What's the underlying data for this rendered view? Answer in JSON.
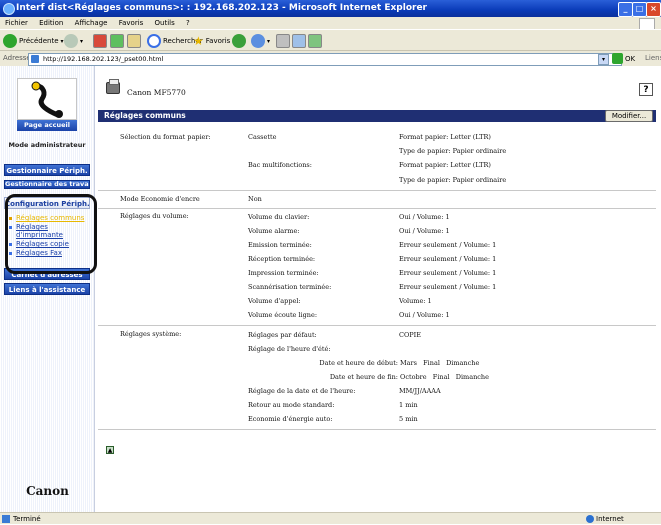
{
  "window": {
    "title": "Interf dist<Réglages communs>: : 192.168.202.123 - Microsoft Internet Explorer"
  },
  "menubar": {
    "items": [
      "Fichier",
      "Edition",
      "Affichage",
      "Favoris",
      "Outils",
      "?"
    ]
  },
  "toolbar": {
    "back_label": "Précédente",
    "search_label": "Rechercher",
    "favorites_label": "Favoris"
  },
  "addressbar": {
    "label": "Adresse",
    "url": "http://192.168.202.123/_pset00.html",
    "go_label": "OK",
    "links_label": "Liens"
  },
  "nav": {
    "home_label": "Page accueil",
    "mode_label": "Mode administrateur",
    "gestionnaire_label": "Gestionnaire Périph.",
    "gestionnaire_travaux_label": "Gestionnaire des travaux",
    "configuration_label": "Configuration Périph.",
    "sub_items": [
      "Réglages communs",
      "Réglages d'imprimante",
      "Réglages copie",
      "Réglages Fax"
    ],
    "carnet_label": "Carnet d'adresses",
    "liens_label": "Liens à l'assistance",
    "brand_label": "Canon"
  },
  "main": {
    "device_name": "Canon MF5770",
    "help_label": "?",
    "section_title": "Réglages communs",
    "modify_label": "Modifier...",
    "format": {
      "label": "Sélection du format papier:",
      "cassette_label": "Cassette",
      "cassette_size": "Format papier: Letter (LTR)",
      "cassette_type": "Type de papier: Papier ordinaire",
      "bac_label": "Bac multifonctions:",
      "bac_size": "Format papier: Letter (LTR)",
      "bac_type": "Type de papier: Papier ordinaire"
    },
    "eco_encre": {
      "label": "Mode Economie d'encre",
      "value": "Non"
    },
    "volume": {
      "label": "Réglages du volume:",
      "rows": [
        {
          "name": "Volume du clavier:",
          "value": "Oui / Volume: 1"
        },
        {
          "name": "Volume alarme:",
          "value": "Oui / Volume: 1"
        },
        {
          "name": "Emission terminée:",
          "value": "Erreur seulement / Volume: 1"
        },
        {
          "name": "Réception terminée:",
          "value": "Erreur seulement / Volume: 1"
        },
        {
          "name": "Impression terminée:",
          "value": "Erreur seulement / Volume: 1"
        },
        {
          "name": "Scannérisation terminée:",
          "value": "Erreur seulement / Volume: 1"
        },
        {
          "name": "Volume d'appel:",
          "value": "Volume: 1"
        },
        {
          "name": "Volume écoute ligne:",
          "value": "Oui / Volume: 1"
        }
      ]
    },
    "systeme": {
      "label": "Réglages système:",
      "defaut_label": "Réglages par défaut:",
      "defaut_value": "COPIE",
      "heure_ete_label": "Réglage de l'heure d'été:",
      "debut_label": "Date et heure de début:",
      "debut_value": "Mars   Final   Dimanche",
      "fin_label": "Date et heure de fin:",
      "fin_value": "Octobre   Final   Dimanche",
      "date_label": "Réglage de la date et de l'heure:",
      "date_value": "MM/JJ/AAAA",
      "retour_label": "Retour au mode standard:",
      "retour_value": "1 min",
      "eco_energie_label": "Economie d'énergie auto:",
      "eco_energie_value": "5 min"
    }
  },
  "status": {
    "left": "Terminé",
    "zone": "Internet"
  }
}
